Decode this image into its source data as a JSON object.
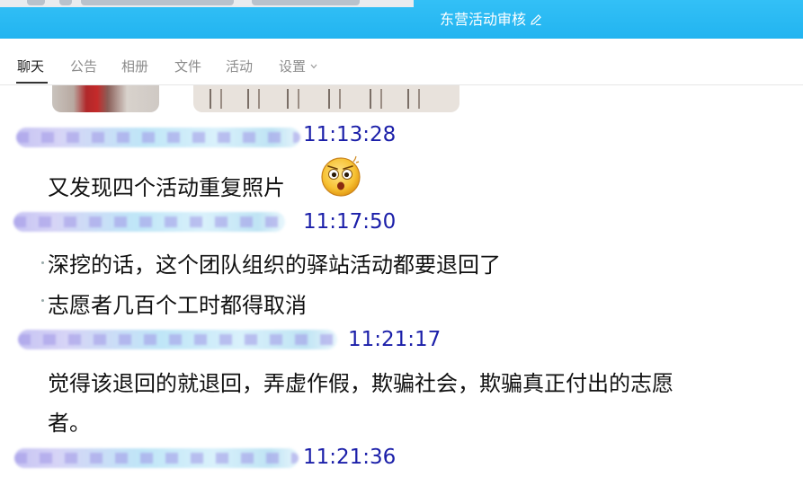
{
  "window": {
    "title": "东营活动审核"
  },
  "tabs": [
    {
      "label": "聊天",
      "active": true
    },
    {
      "label": "公告",
      "active": false
    },
    {
      "label": "相册",
      "active": false
    },
    {
      "label": "文件",
      "active": false
    },
    {
      "label": "活动",
      "active": false
    },
    {
      "label": "设置",
      "active": false
    }
  ],
  "messages": [
    {
      "time": "11:13:28",
      "lines": [
        "又发现四个活动重复照片"
      ],
      "emoji": "shocked-face-icon"
    },
    {
      "time": "11:17:50",
      "lines": [
        "深挖的话，这个团队组织的驿站活动都要退回了",
        "志愿者几百个工时都得取消"
      ]
    },
    {
      "time": "11:21:17",
      "lines": [
        "觉得该退回的就退回，弄虚作假，欺骗社会，欺骗真正付出的志愿",
        "者。"
      ]
    },
    {
      "time": "11:21:36",
      "lines": []
    }
  ],
  "colors": {
    "titlebar": "#22b4f0",
    "timestamp": "#1b1fa9",
    "text": "#111111"
  }
}
